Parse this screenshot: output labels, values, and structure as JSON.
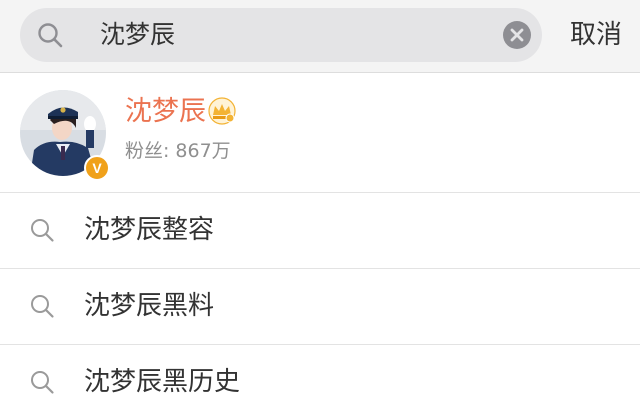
{
  "search": {
    "query": "沈梦辰",
    "icon": "search-icon",
    "clear_icon": "clear-icon"
  },
  "cancel_label": "取消",
  "user_result": {
    "name": "沈梦辰",
    "fans_label": "粉丝:",
    "fans_count": "867万",
    "verified_badge": "V",
    "name_color": "#eb7350",
    "badge_color": "#f0a11a"
  },
  "suggestions": [
    {
      "text": "沈梦辰整容"
    },
    {
      "text": "沈梦辰黑料"
    },
    {
      "text": "沈梦辰黑历史"
    }
  ]
}
